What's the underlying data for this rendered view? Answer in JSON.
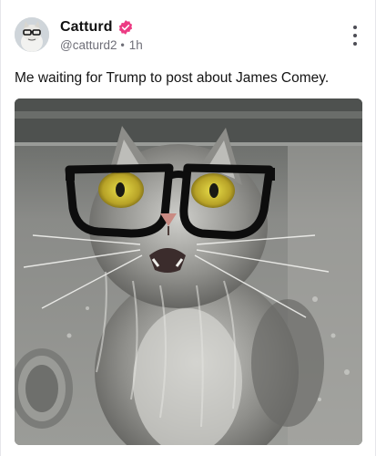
{
  "author": {
    "display_name": "Catturd",
    "handle": "@catturd2",
    "time_ago": "1h",
    "separator": "•",
    "verified": true
  },
  "post": {
    "text": "Me waiting for Trump to post about James Comey."
  },
  "colors": {
    "verified_badge": "#ec3b83",
    "text_primary": "#111111",
    "text_secondary": "#6f6f78"
  },
  "icons": {
    "menu": "vertical-ellipsis-icon",
    "verified": "verified-badge-icon"
  }
}
